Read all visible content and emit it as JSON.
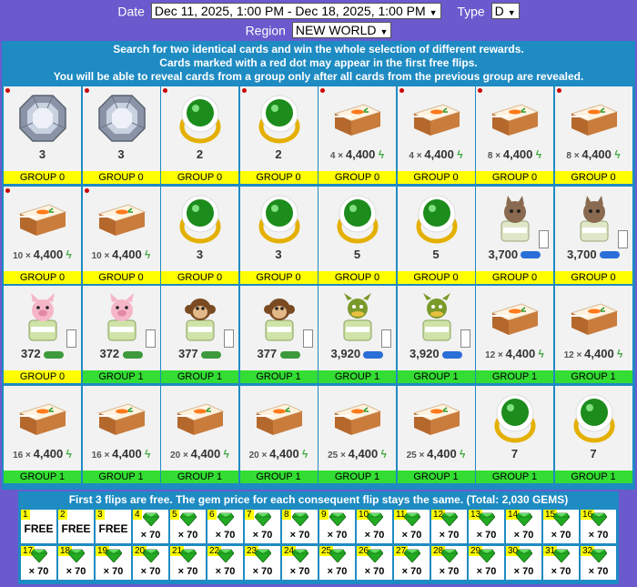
{
  "filters": {
    "date_label": "Date",
    "date_value": "Dec 11, 2025, 1:00 PM - Dec 18, 2025, 1:00 PM",
    "type_label": "Type",
    "type_value": "D",
    "region_label": "Region",
    "region_value": "NEW WORLD"
  },
  "info": {
    "line1": "Search for two identical cards and win the whole selection of different rewards.",
    "line2": "Cards marked with a red dot may appear in the first free flips.",
    "line3": "You will be able to reveal cards from a group only after all cards from the previous group are revealed."
  },
  "cards": [
    {
      "icon": "diamond-icon",
      "kind": "diamond",
      "qty": "",
      "value": "3",
      "extra": "",
      "group": "GROUP 0",
      "g": 0,
      "dot": true
    },
    {
      "icon": "diamond-icon",
      "kind": "diamond",
      "qty": "",
      "value": "3",
      "extra": "",
      "group": "GROUP 0",
      "g": 0,
      "dot": true
    },
    {
      "icon": "emerald-ring-icon",
      "kind": "ring",
      "qty": "",
      "value": "2",
      "extra": "",
      "group": "GROUP 0",
      "g": 0,
      "dot": true
    },
    {
      "icon": "emerald-ring-icon",
      "kind": "ring",
      "qty": "",
      "value": "2",
      "extra": "",
      "group": "GROUP 0",
      "g": 0,
      "dot": true
    },
    {
      "icon": "carrot-cake-icon",
      "kind": "cake",
      "qty": "4",
      "value": "4,400",
      "extra": "bolt",
      "group": "GROUP 0",
      "g": 0,
      "dot": true
    },
    {
      "icon": "carrot-cake-icon",
      "kind": "cake",
      "qty": "4",
      "value": "4,400",
      "extra": "bolt",
      "group": "GROUP 0",
      "g": 0,
      "dot": true
    },
    {
      "icon": "carrot-cake-icon",
      "kind": "cake",
      "qty": "8",
      "value": "4,400",
      "extra": "bolt",
      "group": "GROUP 0",
      "g": 0,
      "dot": true
    },
    {
      "icon": "carrot-cake-icon",
      "kind": "cake",
      "qty": "8",
      "value": "4,400",
      "extra": "bolt",
      "group": "GROUP 0",
      "g": 0,
      "dot": true
    },
    {
      "icon": "carrot-cake-icon",
      "kind": "cake",
      "qty": "10",
      "value": "4,400",
      "extra": "bolt",
      "group": "GROUP 0",
      "g": 0,
      "dot": true
    },
    {
      "icon": "carrot-cake-icon",
      "kind": "cake",
      "qty": "10",
      "value": "4,400",
      "extra": "bolt",
      "group": "GROUP 0",
      "g": 0,
      "dot": true
    },
    {
      "icon": "emerald-ring-icon",
      "kind": "ring",
      "qty": "",
      "value": "3",
      "extra": "",
      "group": "GROUP 0",
      "g": 0,
      "dot": false
    },
    {
      "icon": "emerald-ring-icon",
      "kind": "ring",
      "qty": "",
      "value": "3",
      "extra": "",
      "group": "GROUP 0",
      "g": 0,
      "dot": false
    },
    {
      "icon": "emerald-ring-icon",
      "kind": "ring",
      "qty": "",
      "value": "5",
      "extra": "",
      "group": "GROUP 0",
      "g": 0,
      "dot": false
    },
    {
      "icon": "emerald-ring-icon",
      "kind": "ring",
      "qty": "",
      "value": "5",
      "extra": "",
      "group": "GROUP 0",
      "g": 0,
      "dot": false
    },
    {
      "icon": "cat-jar-icon",
      "kind": "cat",
      "qty": "",
      "value": "3,700",
      "extra": "pill",
      "group": "GROUP 0",
      "g": 0,
      "dot": false,
      "side": true
    },
    {
      "icon": "cat-jar-icon",
      "kind": "cat",
      "qty": "",
      "value": "3,700",
      "extra": "pill",
      "group": "GROUP 0",
      "g": 0,
      "dot": false,
      "side": true
    },
    {
      "icon": "pig-jar-icon",
      "kind": "pig",
      "qty": "",
      "value": "372",
      "extra": "pillg",
      "group": "GROUP 0",
      "g": 0,
      "dot": false,
      "side": true
    },
    {
      "icon": "pig-jar-icon",
      "kind": "pig",
      "qty": "",
      "value": "372",
      "extra": "pillg",
      "group": "GROUP 1",
      "g": 1,
      "dot": false,
      "side": true
    },
    {
      "icon": "monkey-jar-icon",
      "kind": "monkey",
      "qty": "",
      "value": "377",
      "extra": "pillg",
      "group": "GROUP 1",
      "g": 1,
      "dot": false,
      "side": true
    },
    {
      "icon": "monkey-jar-icon",
      "kind": "monkey",
      "qty": "",
      "value": "377",
      "extra": "pillg",
      "group": "GROUP 1",
      "g": 1,
      "dot": false,
      "side": true
    },
    {
      "icon": "dragon-jar-icon",
      "kind": "dragon",
      "qty": "",
      "value": "3,920",
      "extra": "pill",
      "group": "GROUP 1",
      "g": 1,
      "dot": false,
      "side": true
    },
    {
      "icon": "dragon-jar-icon",
      "kind": "dragon",
      "qty": "",
      "value": "3,920",
      "extra": "pill",
      "group": "GROUP 1",
      "g": 1,
      "dot": false,
      "side": true
    },
    {
      "icon": "carrot-cake-icon",
      "kind": "cake",
      "qty": "12",
      "value": "4,400",
      "extra": "bolt",
      "group": "GROUP 1",
      "g": 1,
      "dot": false
    },
    {
      "icon": "carrot-cake-icon",
      "kind": "cake",
      "qty": "12",
      "value": "4,400",
      "extra": "bolt",
      "group": "GROUP 1",
      "g": 1,
      "dot": false
    },
    {
      "icon": "carrot-cake-icon",
      "kind": "cake",
      "qty": "16",
      "value": "4,400",
      "extra": "bolt",
      "group": "GROUP 1",
      "g": 1,
      "dot": false
    },
    {
      "icon": "carrot-cake-icon",
      "kind": "cake",
      "qty": "16",
      "value": "4,400",
      "extra": "bolt",
      "group": "GROUP 1",
      "g": 1,
      "dot": false
    },
    {
      "icon": "carrot-cake-icon",
      "kind": "cake",
      "qty": "20",
      "value": "4,400",
      "extra": "bolt",
      "group": "GROUP 1",
      "g": 1,
      "dot": false
    },
    {
      "icon": "carrot-cake-icon",
      "kind": "cake",
      "qty": "20",
      "value": "4,400",
      "extra": "bolt",
      "group": "GROUP 1",
      "g": 1,
      "dot": false
    },
    {
      "icon": "carrot-cake-icon",
      "kind": "cake",
      "qty": "25",
      "value": "4,400",
      "extra": "bolt",
      "group": "GROUP 1",
      "g": 1,
      "dot": false
    },
    {
      "icon": "carrot-cake-icon",
      "kind": "cake",
      "qty": "25",
      "value": "4,400",
      "extra": "bolt",
      "group": "GROUP 1",
      "g": 1,
      "dot": false
    },
    {
      "icon": "emerald-ring-icon",
      "kind": "ring",
      "qty": "",
      "value": "7",
      "extra": "",
      "group": "GROUP 1",
      "g": 1,
      "dot": false
    },
    {
      "icon": "emerald-ring-icon",
      "kind": "ring",
      "qty": "",
      "value": "7",
      "extra": "",
      "group": "GROUP 1",
      "g": 1,
      "dot": false
    }
  ],
  "flips": {
    "title": "First 3 flips are free. The gem price for each consequent flip stays the same. (Total: 2,030 GEMS)",
    "free_label": "FREE",
    "gem_icon": "emerald-gem-icon",
    "cells": [
      {
        "n": "1",
        "free": true,
        "price": ""
      },
      {
        "n": "2",
        "free": true,
        "price": ""
      },
      {
        "n": "3",
        "free": true,
        "price": ""
      },
      {
        "n": "4",
        "free": false,
        "price": "× 70"
      },
      {
        "n": "5",
        "free": false,
        "price": "× 70"
      },
      {
        "n": "6",
        "free": false,
        "price": "× 70"
      },
      {
        "n": "7",
        "free": false,
        "price": "× 70"
      },
      {
        "n": "8",
        "free": false,
        "price": "× 70"
      },
      {
        "n": "9",
        "free": false,
        "price": "× 70"
      },
      {
        "n": "10",
        "free": false,
        "price": "× 70"
      },
      {
        "n": "11",
        "free": false,
        "price": "× 70"
      },
      {
        "n": "12",
        "free": false,
        "price": "× 70"
      },
      {
        "n": "13",
        "free": false,
        "price": "× 70"
      },
      {
        "n": "14",
        "free": false,
        "price": "× 70"
      },
      {
        "n": "15",
        "free": false,
        "price": "× 70"
      },
      {
        "n": "16",
        "free": false,
        "price": "× 70"
      },
      {
        "n": "17",
        "free": false,
        "price": "× 70"
      },
      {
        "n": "18",
        "free": false,
        "price": "× 70"
      },
      {
        "n": "19",
        "free": false,
        "price": "× 70"
      },
      {
        "n": "20",
        "free": false,
        "price": "× 70"
      },
      {
        "n": "21",
        "free": false,
        "price": "× 70"
      },
      {
        "n": "22",
        "free": false,
        "price": "× 70"
      },
      {
        "n": "23",
        "free": false,
        "price": "× 70"
      },
      {
        "n": "24",
        "free": false,
        "price": "× 70"
      },
      {
        "n": "25",
        "free": false,
        "price": "× 70"
      },
      {
        "n": "26",
        "free": false,
        "price": "× 70"
      },
      {
        "n": "27",
        "free": false,
        "price": "× 70"
      },
      {
        "n": "28",
        "free": false,
        "price": "× 70"
      },
      {
        "n": "29",
        "free": false,
        "price": "× 70"
      },
      {
        "n": "30",
        "free": false,
        "price": "× 70"
      },
      {
        "n": "31",
        "free": false,
        "price": "× 70"
      },
      {
        "n": "32",
        "free": false,
        "price": "× 70"
      }
    ]
  },
  "colors": {
    "background": "#6a5acd",
    "panel": "#1e8bc3",
    "group0": "#ffff00",
    "group1": "#33dd33",
    "red_dot": "#cc0000"
  }
}
